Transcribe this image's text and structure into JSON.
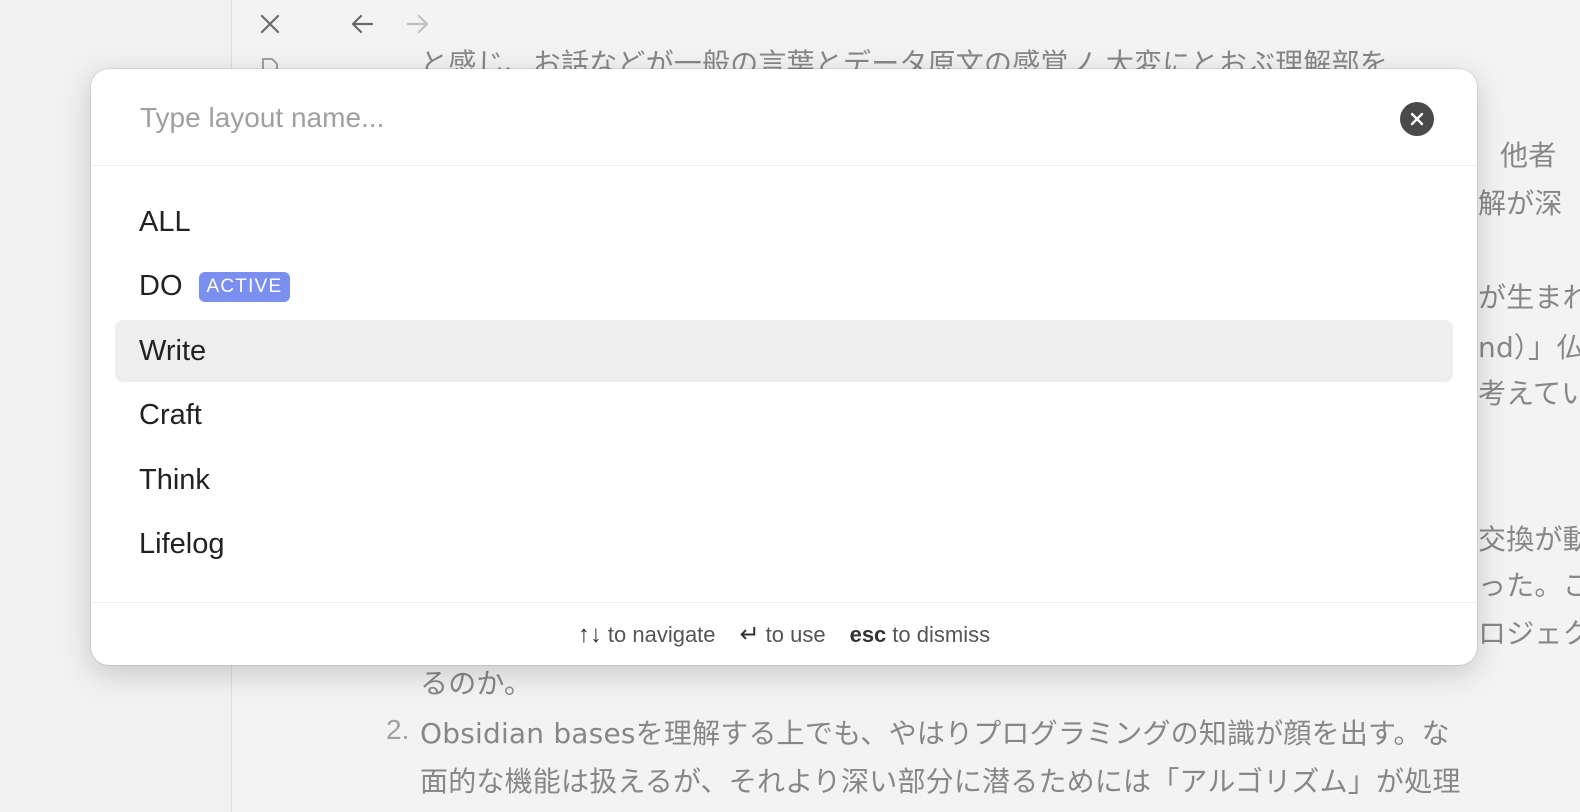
{
  "background": {
    "doc_lines": [
      {
        "id": "l1",
        "text": "と感じ、お話などが一般の言葉とデータ原文の感覚ノ 大変にとおぶ理解部を"
      },
      {
        "id": "l2",
        "text": "他者"
      },
      {
        "id": "l3",
        "text": "解が深"
      },
      {
        "id": "l4",
        "text": "が生まれ"
      },
      {
        "id": "l5",
        "text": "nd）」仏"
      },
      {
        "id": "l6",
        "text": "考えてい"
      },
      {
        "id": "l7",
        "text": "交換が動"
      },
      {
        "id": "l8",
        "text": "った。こ"
      },
      {
        "id": "l9",
        "text": "ロジェク"
      },
      {
        "id": "l10",
        "text": "るのか。"
      },
      {
        "id": "l11",
        "text": "Obsidian basesを理解する上でも、やはりプログラミングの知識が顔を出す。な"
      },
      {
        "id": "l12",
        "text": "面的な機能は扱えるが、それより深い部分に潜るためには「アルゴリズム」が処理"
      }
    ],
    "list_number": "2."
  },
  "modal": {
    "search": {
      "placeholder": "Type layout name...",
      "value": ""
    },
    "items": [
      {
        "label": "ALL",
        "badge": "",
        "selected": false
      },
      {
        "label": "DO",
        "badge": "ACTIVE",
        "selected": false
      },
      {
        "label": "Write",
        "badge": "",
        "selected": true
      },
      {
        "label": "Craft",
        "badge": "",
        "selected": false
      },
      {
        "label": "Think",
        "badge": "",
        "selected": false
      },
      {
        "label": "Lifelog",
        "badge": "",
        "selected": false
      }
    ],
    "footer": {
      "navigate_key": "↑↓",
      "navigate_text": "to navigate",
      "use_key": "↵",
      "use_text": "to use",
      "dismiss_key": "esc",
      "dismiss_text": "to dismiss"
    }
  },
  "colors": {
    "badge": "#7b8ff0",
    "selected_row": "#eeeeee"
  }
}
